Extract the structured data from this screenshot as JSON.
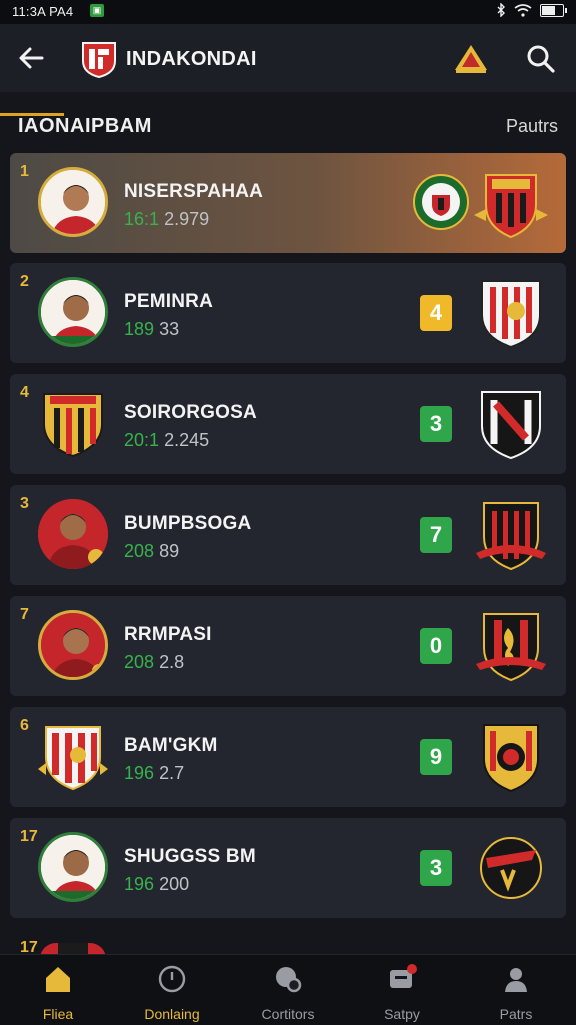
{
  "status_bar": {
    "time": "11:3A PA4",
    "notif_glyph": "▣"
  },
  "app_bar": {
    "title": "INDAKONDAI"
  },
  "section": {
    "title": "IAONAIPBAM",
    "link": "Pautrs"
  },
  "rows": [
    {
      "rank": "1",
      "name": "NISERSPAHAA",
      "stat_green": "16:1",
      "stat_rest": "2.979",
      "badge": "",
      "highlight": true,
      "avatar": "player",
      "crest_type": "double"
    },
    {
      "rank": "2",
      "name": "PEMINRA",
      "stat_green": "189",
      "stat_rest": "33",
      "badge": "4",
      "badge_color": "yellow",
      "avatar": "player-green",
      "crest_type": "striped-red"
    },
    {
      "rank": "4",
      "name": "SOIRORGOSA",
      "stat_green": "20:1",
      "stat_rest": "2.245",
      "badge": "3",
      "badge_color": "green",
      "avatar": "crest",
      "crest_type": "black-red"
    },
    {
      "rank": "3",
      "name": "BUMPBSOGA",
      "stat_green": "208",
      "stat_rest": "89",
      "badge": "7",
      "badge_color": "green",
      "avatar": "player-red",
      "crest_type": "black-stripes"
    },
    {
      "rank": "7",
      "name": "RRMPASI",
      "stat_green": "208",
      "stat_rest": "2.8",
      "badge": "0",
      "badge_color": "green",
      "avatar": "player-red",
      "crest_type": "black-gold"
    },
    {
      "rank": "6",
      "name": "BAM'GKM",
      "stat_green": "196",
      "stat_rest": "2.7",
      "badge": "9",
      "badge_color": "green",
      "avatar": "crest-red",
      "crest_type": "red-gold"
    },
    {
      "rank": "17",
      "name": "SHUGGSS BM",
      "stat_green": "196",
      "stat_rest": "200",
      "badge": "3",
      "badge_color": "green",
      "avatar": "player-green",
      "crest_type": "black-red"
    },
    {
      "rank": "17",
      "name": "",
      "stat_green": "",
      "stat_rest": "",
      "badge": "",
      "avatar": "partial",
      "crest_type": ""
    }
  ],
  "nav": [
    {
      "label": "Fliea",
      "icon": "home-icon",
      "active": true
    },
    {
      "label": "Donlaing",
      "icon": "compass-icon",
      "active": true
    },
    {
      "label": "Cortitors",
      "icon": "stats-icon",
      "active": false
    },
    {
      "label": "Satpy",
      "icon": "inbox-icon",
      "active": false
    },
    {
      "label": "Patrs",
      "icon": "person-icon",
      "active": false
    }
  ],
  "colors": {
    "accent": "#e7b93a",
    "green": "#2fa64a",
    "bg": "#14161b",
    "card": "#23262e"
  }
}
